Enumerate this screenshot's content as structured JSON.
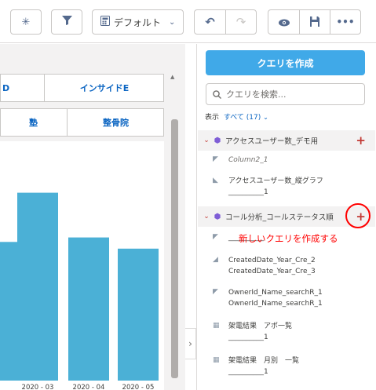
{
  "toolbar": {
    "dropdown_label": "デフォルト",
    "icons": {
      "asterisk": "asterisk-icon",
      "filter": "filter-icon",
      "calculator": "calculator-icon",
      "undo": "undo-icon",
      "redo": "redo-icon",
      "view": "eye-icon",
      "save": "save-icon",
      "more": "more-icon"
    }
  },
  "table": {
    "row1": [
      "D",
      "インサイドE"
    ],
    "row2": [
      "塾",
      "整骨院"
    ]
  },
  "chart_data": {
    "type": "bar",
    "categories": [
      "2",
      "2020 - 03",
      "2020 - 04",
      "2020 - 05"
    ],
    "values": [
      62,
      84,
      64,
      59
    ],
    "ylim": [
      0,
      100
    ],
    "color": "#4bb0d6"
  },
  "panel": {
    "create_button": "クエリを作成",
    "search_placeholder": "クエリを検索...",
    "show_label": "表示",
    "show_filter": "すべて (17)",
    "groups": [
      {
        "name": "アクセスユーザー数_デモ用",
        "items": [
          {
            "lines": [
              "Column2_1"
            ],
            "icon": "line-chart-icon",
            "italic": true
          },
          {
            "lines": [
              "アクセスユーザー数_縦グラフ",
              "__________1"
            ],
            "icon": "bar-chart-icon",
            "italic": false
          }
        ]
      },
      {
        "name": "コール分析_コールステータス順",
        "items": [
          {
            "lines": [
              "__________"
            ],
            "icon": "line-chart-icon",
            "italic": false
          },
          {
            "lines": [
              "CreatedDate_Year_Cre_2",
              "CreatedDate_Year_Cre_3"
            ],
            "icon": "area-chart-icon",
            "italic": false
          },
          {
            "lines": [
              "OwnerId_Name_searchR_1",
              "OwnerId_Name_searchR_1"
            ],
            "icon": "line-chart-icon",
            "italic": false
          },
          {
            "lines": [
              "架電結果　アポ一覧",
              "__________1"
            ],
            "icon": "table-icon",
            "italic": false
          },
          {
            "lines": [
              "架電結果　月別　一覧",
              "__________1"
            ],
            "icon": "table-icon",
            "italic": false
          }
        ]
      }
    ]
  },
  "annotation": "新しいクエリを作成する"
}
